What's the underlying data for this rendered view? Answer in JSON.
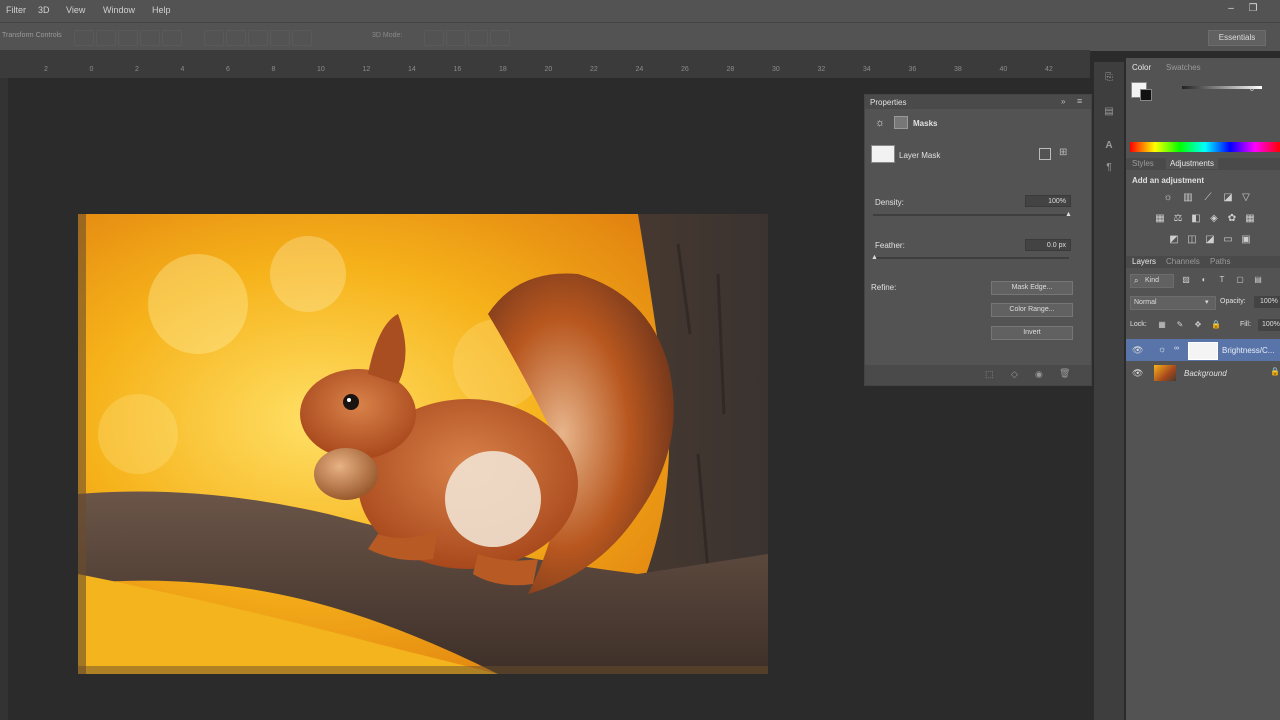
{
  "menu": {
    "items": [
      "Filter",
      "3D",
      "View",
      "Window",
      "Help"
    ]
  },
  "options_bar": {
    "label": "Transform Controls",
    "mode_label": "3D Mode:",
    "workspace": "Essentials"
  },
  "ruler": {
    "numbers": [
      "2",
      "0",
      "2",
      "4",
      "6",
      "8",
      "10",
      "12",
      "14",
      "16",
      "18",
      "20",
      "22",
      "24",
      "26",
      "28",
      "30",
      "32",
      "34",
      "36",
      "38",
      "40",
      "42"
    ]
  },
  "properties": {
    "title": "Properties",
    "section": "Masks",
    "mask_type": "Layer Mask",
    "density_label": "Density:",
    "density_value": "100%",
    "feather_label": "Feather:",
    "feather_value": "0.0 px",
    "refine_label": "Refine:",
    "buttons": [
      "Mask Edge...",
      "Color Range...",
      "Invert"
    ]
  },
  "color_panel": {
    "tabs": [
      "Color",
      "Swatches"
    ],
    "value": "0"
  },
  "adjustments_panel": {
    "tabs": [
      "Styles",
      "Adjustments"
    ],
    "heading": "Add an adjustment"
  },
  "layers_panel": {
    "tabs": [
      "Layers",
      "Channels",
      "Paths"
    ],
    "kind_label": "Kind",
    "blend_mode": "Normal",
    "opacity_label": "Opacity:",
    "opacity_value": "100%",
    "lock_label": "Lock:",
    "fill_label": "Fill:",
    "fill_value": "100%",
    "layers": [
      {
        "name": "Brightness/C...",
        "selected": true
      },
      {
        "name": "Background",
        "selected": false
      }
    ]
  },
  "colors": {
    "ui_panel": "#535353",
    "ui_dark": "#2b2b2b",
    "selected_layer": "#5874a8"
  }
}
